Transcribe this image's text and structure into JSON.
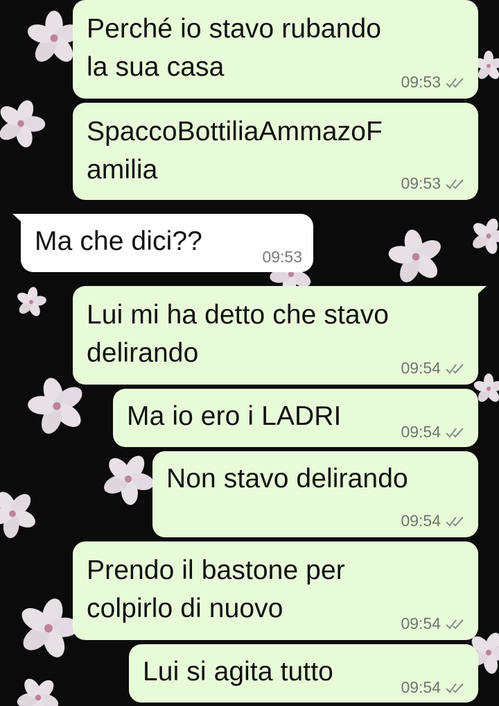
{
  "colors": {
    "background": "#0b0b0c",
    "outgoing_bubble": "#e8fbd9",
    "incoming_bubble": "#ffffff",
    "meta_text": "#6e776c",
    "read_ticks": "#8a9488"
  },
  "messages": [
    {
      "direction": "out",
      "text": "Perché io stavo rubando\nla sua casa",
      "time": "09:53",
      "status": "read"
    },
    {
      "direction": "out",
      "text": "SpaccoBottiliaAmmazoF\namilia",
      "time": "09:53",
      "status": "read"
    },
    {
      "direction": "in",
      "text": "Ma che dici??",
      "time": "09:53"
    },
    {
      "direction": "out",
      "text": "Lui mi ha detto che stavo\ndelirando",
      "time": "09:54",
      "status": "read"
    },
    {
      "direction": "out",
      "text": "Ma io ero i LADRI",
      "time": "09:54",
      "status": "read"
    },
    {
      "direction": "out",
      "text": "Non stavo delirando",
      "time": "09:54",
      "status": "read"
    },
    {
      "direction": "out",
      "text": "Prendo il bastone per\ncolpirlo di nuovo",
      "time": "09:54",
      "status": "read"
    },
    {
      "direction": "out",
      "text": "Lui si agita tutto",
      "time": "09:54",
      "status": "read"
    }
  ],
  "icons": {
    "read_status": "double-check-icon",
    "wallpaper": "cherry-blossom-wallpaper"
  }
}
